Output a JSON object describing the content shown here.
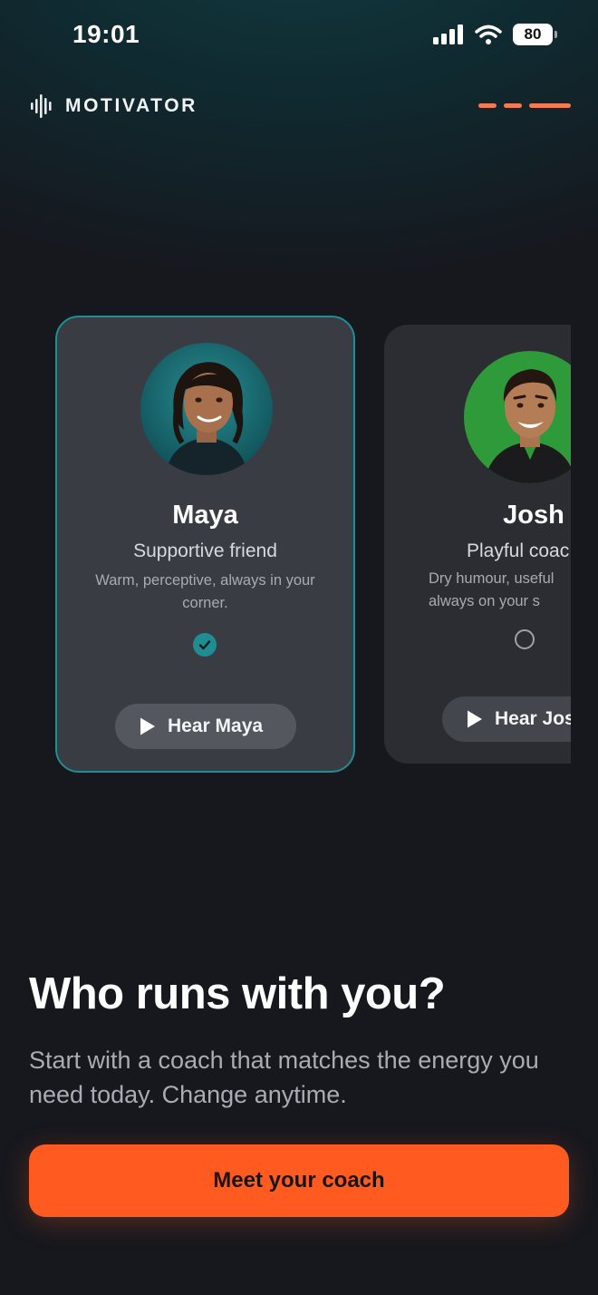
{
  "status_bar": {
    "time": "19:01",
    "battery": "80"
  },
  "header": {
    "brand": "MOTIVATOR"
  },
  "coaches": [
    {
      "name": "Maya",
      "role": "Supportive friend",
      "description": "Warm, perceptive, always in your corner.",
      "button": "Hear Maya",
      "selected": true
    },
    {
      "name": "Josh",
      "role": "Playful coac",
      "description": "Dry humour, useful always on your s",
      "button": "Hear Jos",
      "selected": false
    }
  ],
  "main": {
    "headline": "Who runs with you?",
    "subtext": "Start with a coach that matches the energy you need today. Change anytime.",
    "cta": "Meet your coach"
  },
  "colors": {
    "accent": "#ff5a1f",
    "teal": "#1e8e92",
    "progress": "#f37a52"
  },
  "icons": [
    "signal-icon",
    "wifi-icon",
    "battery-icon",
    "waveform-icon",
    "check-icon",
    "play-icon"
  ]
}
